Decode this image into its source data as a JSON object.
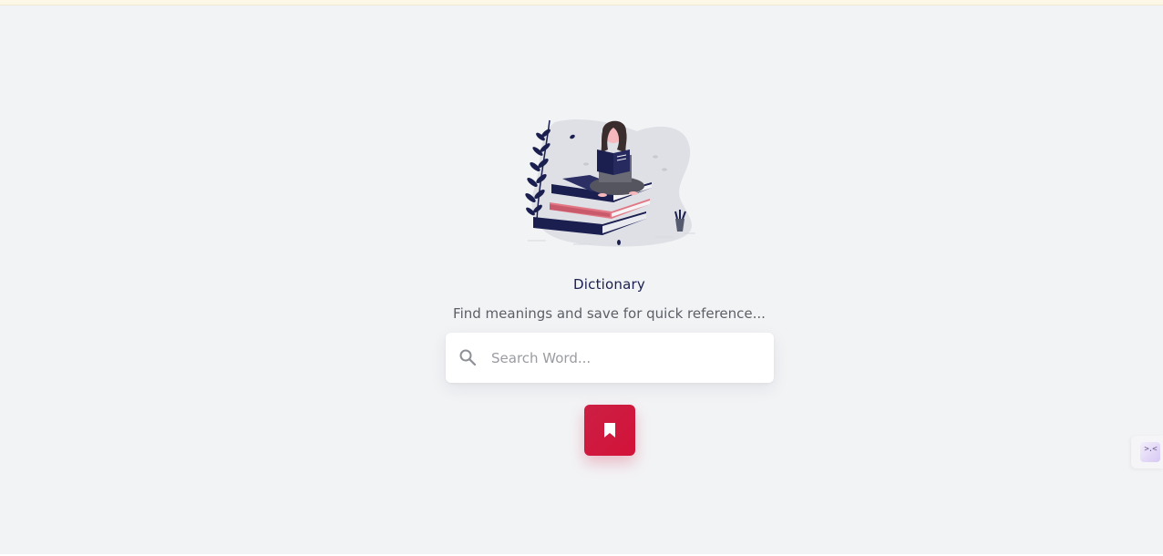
{
  "app": {
    "title": "Dictionary",
    "subtitle": "Find meanings and save for quick reference..."
  },
  "search": {
    "placeholder": "Search Word...",
    "value": "",
    "icon": "search-icon"
  },
  "bookmark_button": {
    "icon": "bookmark-icon"
  },
  "side_widget": {
    "glyph": ">.<"
  },
  "colors": {
    "background": "#f2f3f5",
    "title": "#1b1f4f",
    "accent": "#d01a3f"
  }
}
